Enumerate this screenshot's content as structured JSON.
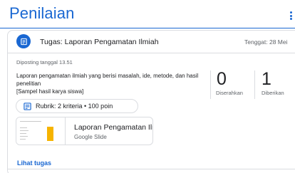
{
  "page": {
    "title": "Penilaian"
  },
  "assignment": {
    "header_title": "Tugas: Laporan Pengamatan Ilmiah",
    "due": "Tenggat: 28 Mei",
    "posted": "Diposting tanggal 13.51",
    "description_lines": [
      "Laporan pengamatan ilmiah yang berisi masalah, ide, metode, dan hasil penelitian",
      "[Sampel hasil karya siswa]"
    ]
  },
  "stats": {
    "submitted": {
      "count": "0",
      "label": "Diserahkan"
    },
    "assigned": {
      "count": "1",
      "label": "Diberikan"
    }
  },
  "rubric": {
    "label": "Rubrik: 2 kriteria • 100 poin"
  },
  "attachment": {
    "title": "Laporan Pengamatan Ilmi...",
    "type": "Google Slide"
  },
  "footer": {
    "view_label": "Lihat tugas"
  },
  "colors": {
    "accent": "#1967d2",
    "slide_yellow": "#f6b400",
    "border": "#dadce0",
    "muted_text": "#5f6368"
  },
  "icons": {
    "header": "assignment-icon",
    "rubric": "rubric-icon",
    "menu": "more-vert-icon"
  }
}
